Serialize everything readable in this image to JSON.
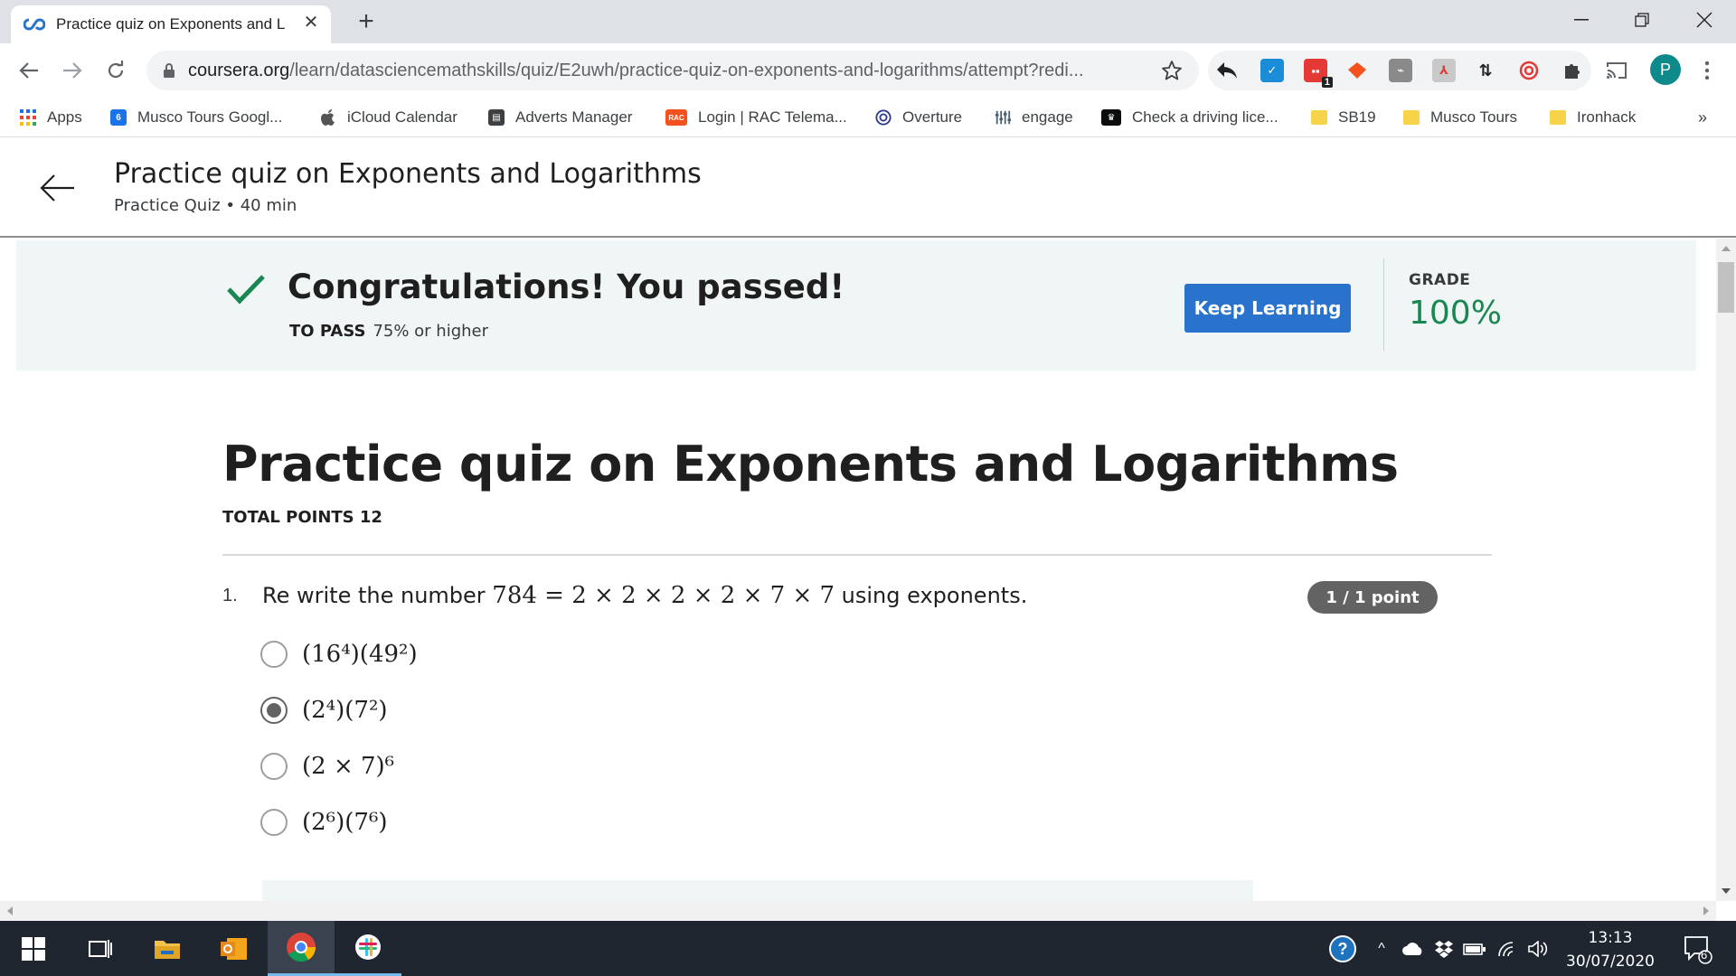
{
  "browser": {
    "tab_title": "Practice quiz on Exponents and L",
    "url_host": "coursera.org",
    "url_path": "/learn/datasciencemathskills/quiz/E2uwh/practice-quiz-on-exponents-and-logarithms/attempt?redi...",
    "ext_badge": "1",
    "profile_initial": "P"
  },
  "bookmarks": [
    {
      "label": "Apps",
      "icon": "apps-grid-icon"
    },
    {
      "label": "Musco Tours Googl...",
      "icon": "google-calendar-icon"
    },
    {
      "label": "iCloud Calendar",
      "icon": "apple-icon"
    },
    {
      "label": "Adverts Manager",
      "icon": "adverts-manager-icon"
    },
    {
      "label": "Login | RAC Telema...",
      "icon": "rac-icon"
    },
    {
      "label": "Overture",
      "icon": "overture-icon"
    },
    {
      "label": "engage",
      "icon": "engage-icon"
    },
    {
      "label": "Check a driving lice...",
      "icon": "gov-crown-icon"
    },
    {
      "label": "SB19",
      "icon": "folder-icon"
    },
    {
      "label": "Musco Tours",
      "icon": "folder-icon"
    },
    {
      "label": "Ironhack",
      "icon": "folder-icon"
    }
  ],
  "bookmarks_overflow": "»",
  "calendar_badge": "6",
  "page_header": {
    "title": "Practice quiz on Exponents and Logarithms",
    "subtitle": "Practice Quiz • 40 min"
  },
  "banner": {
    "message": "Congratulations! You passed!",
    "to_pass_label": "TO PASS",
    "to_pass_value": "75% or higher",
    "button": "Keep Learning",
    "grade_label": "GRADE",
    "grade_value": "100%"
  },
  "quiz": {
    "title": "Practice quiz on Exponents and Logarithms",
    "total_points": "TOTAL POINTS 12",
    "question": {
      "number": "1.",
      "text_prefix": "Re write the number ",
      "math": "784 = 2 × 2 × 2 × 2 × 7 × 7",
      "text_suffix": " using exponents.",
      "points": "1 / 1 point",
      "options": [
        {
          "text": "(16⁴)(49²)",
          "selected": false
        },
        {
          "text": "(2⁴)(7²)",
          "selected": true
        },
        {
          "text": "(2 × 7)⁶",
          "selected": false
        },
        {
          "text": "(2⁶)(7⁶)",
          "selected": false
        }
      ]
    }
  },
  "taskbar": {
    "time": "13:13",
    "date": "30/07/2020",
    "notification_count": "6"
  },
  "colors": {
    "accent_blue": "#2a73cc",
    "pass_green": "#1a8651",
    "banner_bg": "#f0f6f6",
    "points_badge": "#636363"
  }
}
